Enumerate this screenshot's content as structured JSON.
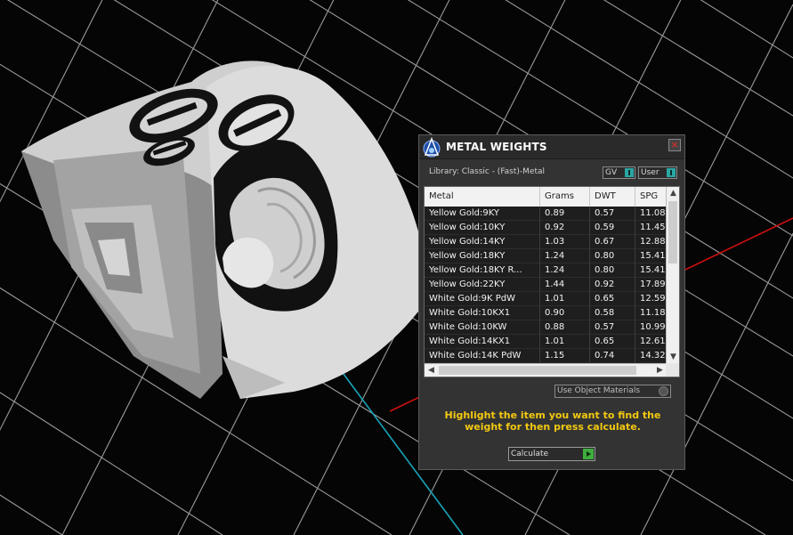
{
  "panel": {
    "title": "METAL WEIGHTS",
    "close_label": "×",
    "library_label": "Library: Classic - (Fast)-Metal",
    "toggles": [
      {
        "label": "GV",
        "state": "on"
      },
      {
        "label": "User",
        "state": "on"
      }
    ],
    "table": {
      "columns": [
        "Metal",
        "Grams",
        "DWT",
        "SPG"
      ],
      "rows": [
        [
          "Yellow Gold:9KY",
          "0.89",
          "0.57",
          "11.08"
        ],
        [
          "Yellow Gold:10KY",
          "0.92",
          "0.59",
          "11.45"
        ],
        [
          "Yellow Gold:14KY",
          "1.03",
          "0.67",
          "12.88"
        ],
        [
          "Yellow Gold:18KY",
          "1.24",
          "0.80",
          "15.41"
        ],
        [
          "Yellow Gold:18KY R...",
          "1.24",
          "0.80",
          "15.41"
        ],
        [
          "Yellow Gold:22KY",
          "1.44",
          "0.92",
          "17.89"
        ],
        [
          "White Gold:9K PdW",
          "1.01",
          "0.65",
          "12.59"
        ],
        [
          "White Gold:10KX1",
          "0.90",
          "0.58",
          "11.18"
        ],
        [
          "White Gold:10KW",
          "0.88",
          "0.57",
          "10.99"
        ],
        [
          "White Gold:14KX1",
          "1.01",
          "0.65",
          "12.61"
        ],
        [
          "White Gold:14K PdW",
          "1.15",
          "0.74",
          "14.32"
        ]
      ]
    },
    "use_object_materials_label": "Use Object Materials",
    "hint": "Highlight the item you want to find the weight for then press calculate.",
    "calculate_label": "Calculate"
  },
  "icons": {
    "app": "jcad-app-icon",
    "close": "close-icon",
    "scroll_up": "chevron-up-icon",
    "scroll_down": "chevron-down-icon",
    "scroll_left": "chevron-left-icon",
    "scroll_right": "chevron-right-icon",
    "play": "play-icon"
  },
  "colors": {
    "background": "#050505",
    "grid": "#9a9a9a",
    "axis_x": "#d01010",
    "axis_y": "#19a3b8",
    "hint_text": "#f2c811",
    "toggle_on": "#2aa7a4",
    "calc_go": "#3fae3f"
  }
}
